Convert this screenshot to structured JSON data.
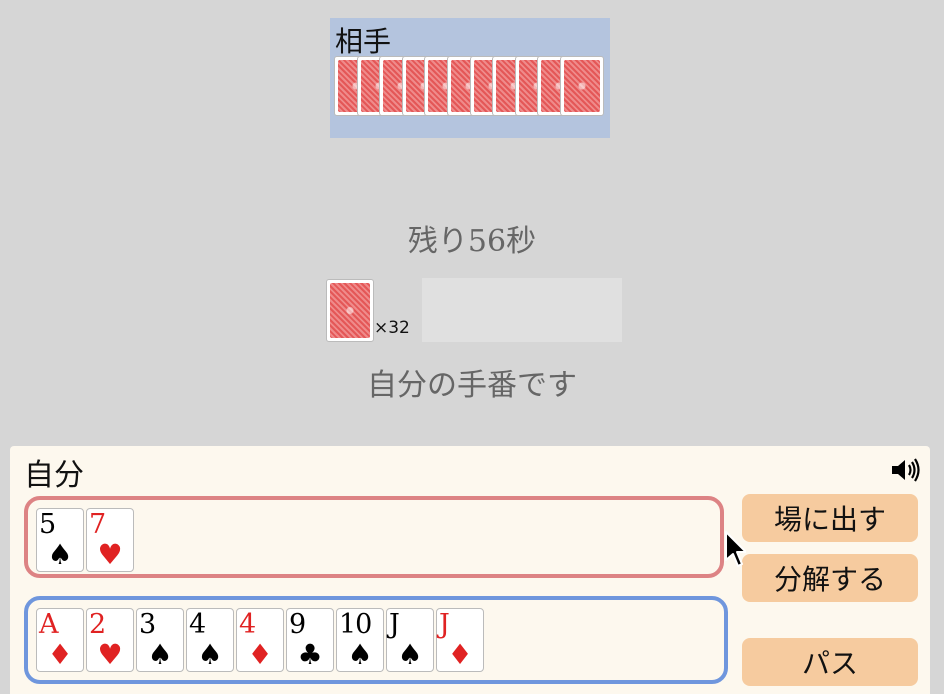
{
  "opponent": {
    "label": "相手",
    "card_count": 11
  },
  "timer": {
    "text": "残り56秒"
  },
  "deck": {
    "count_text": "×32"
  },
  "turn": {
    "message": "自分の手番です"
  },
  "player": {
    "label": "自分",
    "sound_icon": "speaker-icon",
    "selected_cards": [
      {
        "rank": "5",
        "suit": "♠",
        "color": "black"
      },
      {
        "rank": "7",
        "suit": "♥",
        "color": "red"
      }
    ],
    "hand_cards": [
      {
        "rank": "A",
        "suit": "♦",
        "color": "red"
      },
      {
        "rank": "2",
        "suit": "♥",
        "color": "red"
      },
      {
        "rank": "3",
        "suit": "♠",
        "color": "black"
      },
      {
        "rank": "4",
        "suit": "♠",
        "color": "black"
      },
      {
        "rank": "4",
        "suit": "♦",
        "color": "red"
      },
      {
        "rank": "9",
        "suit": "♣",
        "color": "black"
      },
      {
        "rank": "10",
        "suit": "♠",
        "color": "black"
      },
      {
        "rank": "J",
        "suit": "♠",
        "color": "black"
      },
      {
        "rank": "J",
        "suit": "♦",
        "color": "red"
      }
    ]
  },
  "buttons": {
    "play": "場に出す",
    "split": "分解する",
    "pass": "パス"
  },
  "colors": {
    "background": "#d6d6d6",
    "opponent_area": "#b4c4de",
    "panel": "#fdf8ee",
    "selected_border": "#dd8384",
    "hand_border": "#6f96dd",
    "button": "#f6cb9f",
    "card_back": "#e25a5a",
    "red_suit": "#e02222"
  }
}
